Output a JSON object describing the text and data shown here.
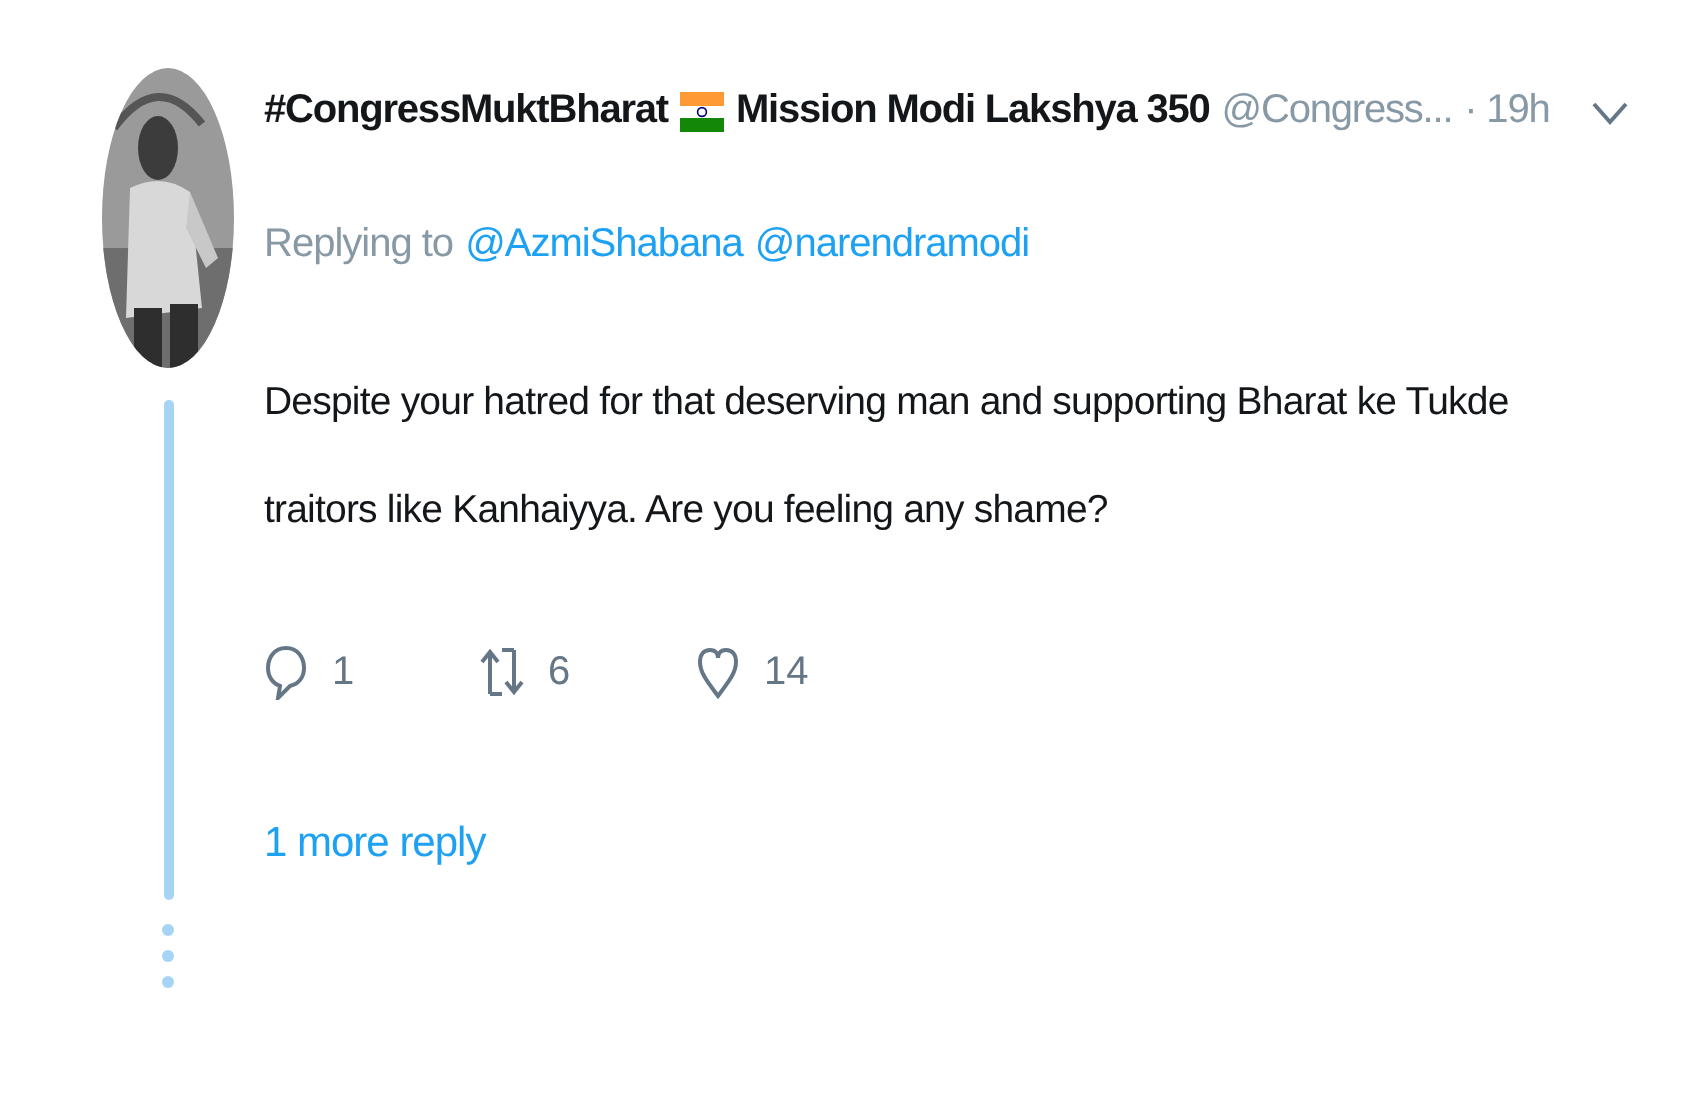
{
  "tweet": {
    "name_part_1": "#CongressMuktBharat",
    "name_part_2": "Mission Modi Lakshya 350",
    "handle": "@Congress...",
    "time": "· 19h",
    "replying_label": "Replying to",
    "replying_to": [
      "@AzmiShabana",
      "@narendramodi"
    ],
    "text": "Despite your hatred for that deserving man and supporting Bharat ke Tukde traitors like Kanhaiyya. Are you feeling any shame?",
    "actions": [
      {
        "kind": "reply",
        "count": "1"
      },
      {
        "kind": "retweet",
        "count": "6"
      },
      {
        "kind": "like",
        "count": "14"
      }
    ],
    "more_replies": "1 more reply"
  }
}
